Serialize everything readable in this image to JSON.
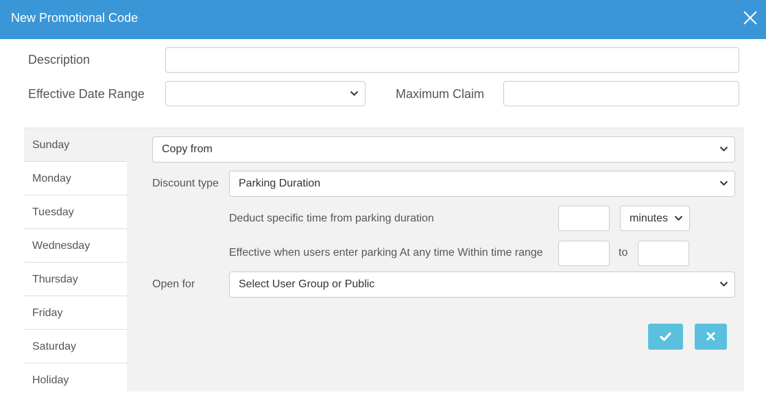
{
  "dialog": {
    "title": "New Promotional Code"
  },
  "form": {
    "description_label": "Description",
    "description_value": "",
    "date_range_label": "Effective Date Range",
    "date_range_value": "",
    "max_claim_label": "Maximum Claim",
    "max_claim_value": ""
  },
  "days": [
    "Sunday",
    "Monday",
    "Tuesday",
    "Wednesday",
    "Thursday",
    "Friday",
    "Saturday",
    "Holiday"
  ],
  "selected_day": "Sunday",
  "detail": {
    "copy_from": "Copy from",
    "discount_type_label": "Discount type",
    "discount_type_value": "Parking Duration",
    "deduct_label": "Deduct specific time from parking duration",
    "deduct_value": "",
    "unit_value": "minutes",
    "effective_label": "Effective when users enter parking At any time Within time range",
    "range_from": "",
    "range_to_label": "to",
    "range_to": "",
    "open_for_label": "Open for",
    "open_for_value": "Select User Group or Public"
  },
  "colors": {
    "header": "#3a96d6",
    "button": "#5bc0de",
    "panel": "#f2f2f2"
  },
  "icons": {
    "close": "close-icon",
    "confirm": "check-icon",
    "cancel": "times-icon",
    "dropdown": "chevron-down-icon"
  }
}
